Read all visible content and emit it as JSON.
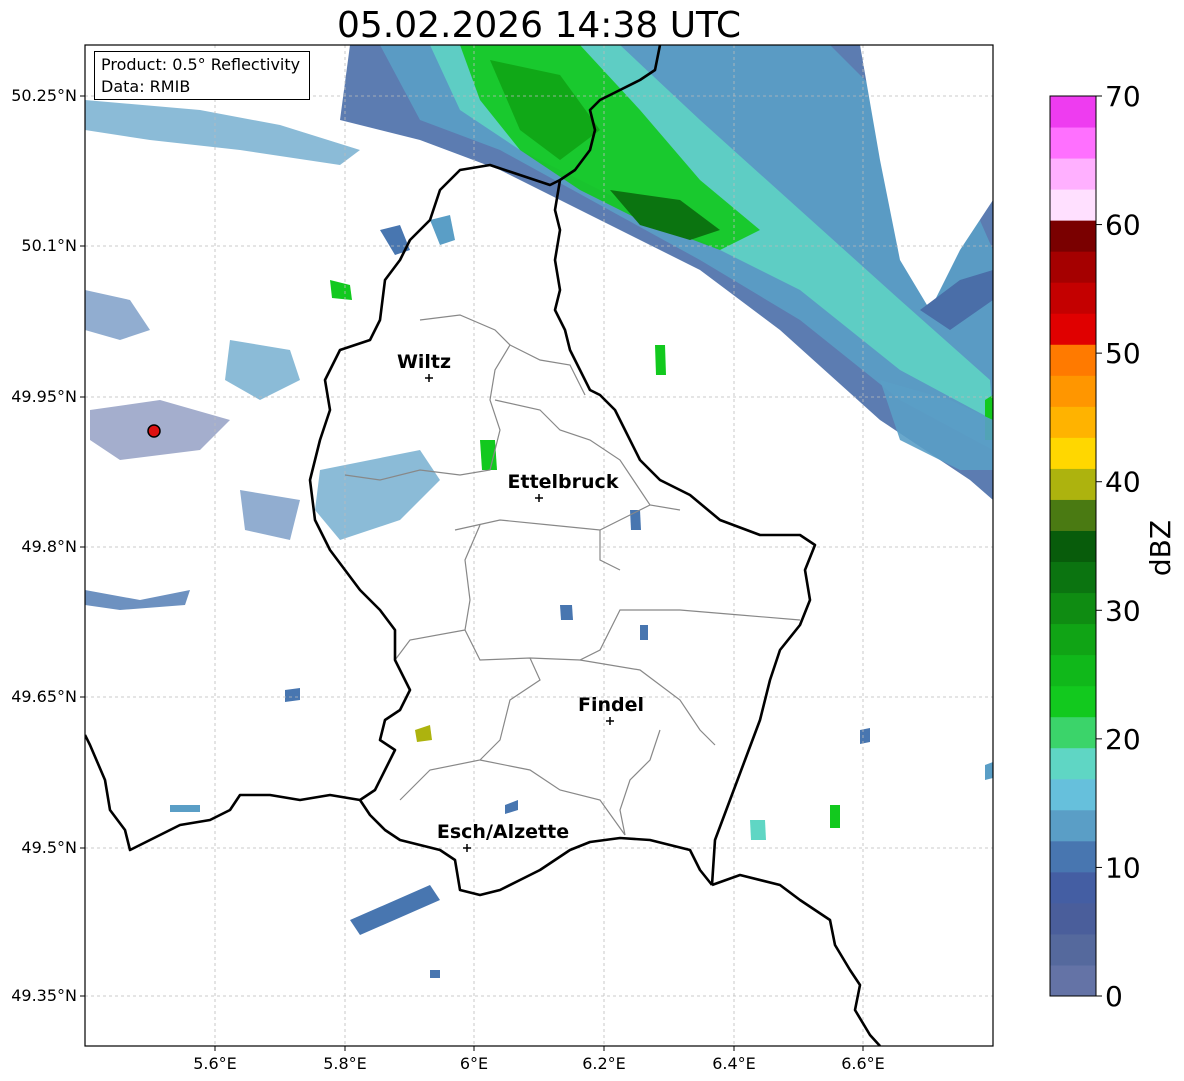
{
  "title": "05.02.2026 14:38 UTC",
  "info": {
    "product": "Product: 0.5° Reflectivity",
    "data": "Data: RMIB"
  },
  "axes": {
    "lon_ticks": [
      "5.6°E",
      "5.8°E",
      "6°E",
      "6.2°E",
      "6.4°E",
      "6.6°E"
    ],
    "lat_ticks": [
      "50.25°N",
      "50.1°N",
      "49.95°N",
      "49.8°N",
      "49.65°N",
      "49.5°N",
      "49.35°N"
    ]
  },
  "cities": [
    {
      "name": "Wiltz"
    },
    {
      "name": "Ettelbruck"
    },
    {
      "name": "Findel"
    },
    {
      "name": "Esch/Alzette"
    }
  ],
  "colorbar": {
    "label": "dBZ",
    "ticks": [
      "0",
      "10",
      "20",
      "30",
      "40",
      "50",
      "60",
      "70"
    ],
    "colors": [
      "#6473a6",
      "#55699d",
      "#4a5e9b",
      "#445ea3",
      "#4876b0",
      "#5a9ec6",
      "#66c0dc",
      "#5fd6c4",
      "#3bd46a",
      "#12c91e",
      "#10b81a",
      "#10a415",
      "#0f8c12",
      "#0b7410",
      "#085c0b",
      "#4a7a12",
      "#adb30e",
      "#ffd700",
      "#ffb300",
      "#ff9600",
      "#ff7a00",
      "#e00000",
      "#c40000",
      "#a50000",
      "#7a0000",
      "#ffe0ff",
      "#ffb0ff",
      "#ff70ff",
      "#ee3cf0"
    ]
  },
  "colors": {
    "border": "#000000",
    "district": "#888888",
    "radar_site": "#dd1111"
  }
}
